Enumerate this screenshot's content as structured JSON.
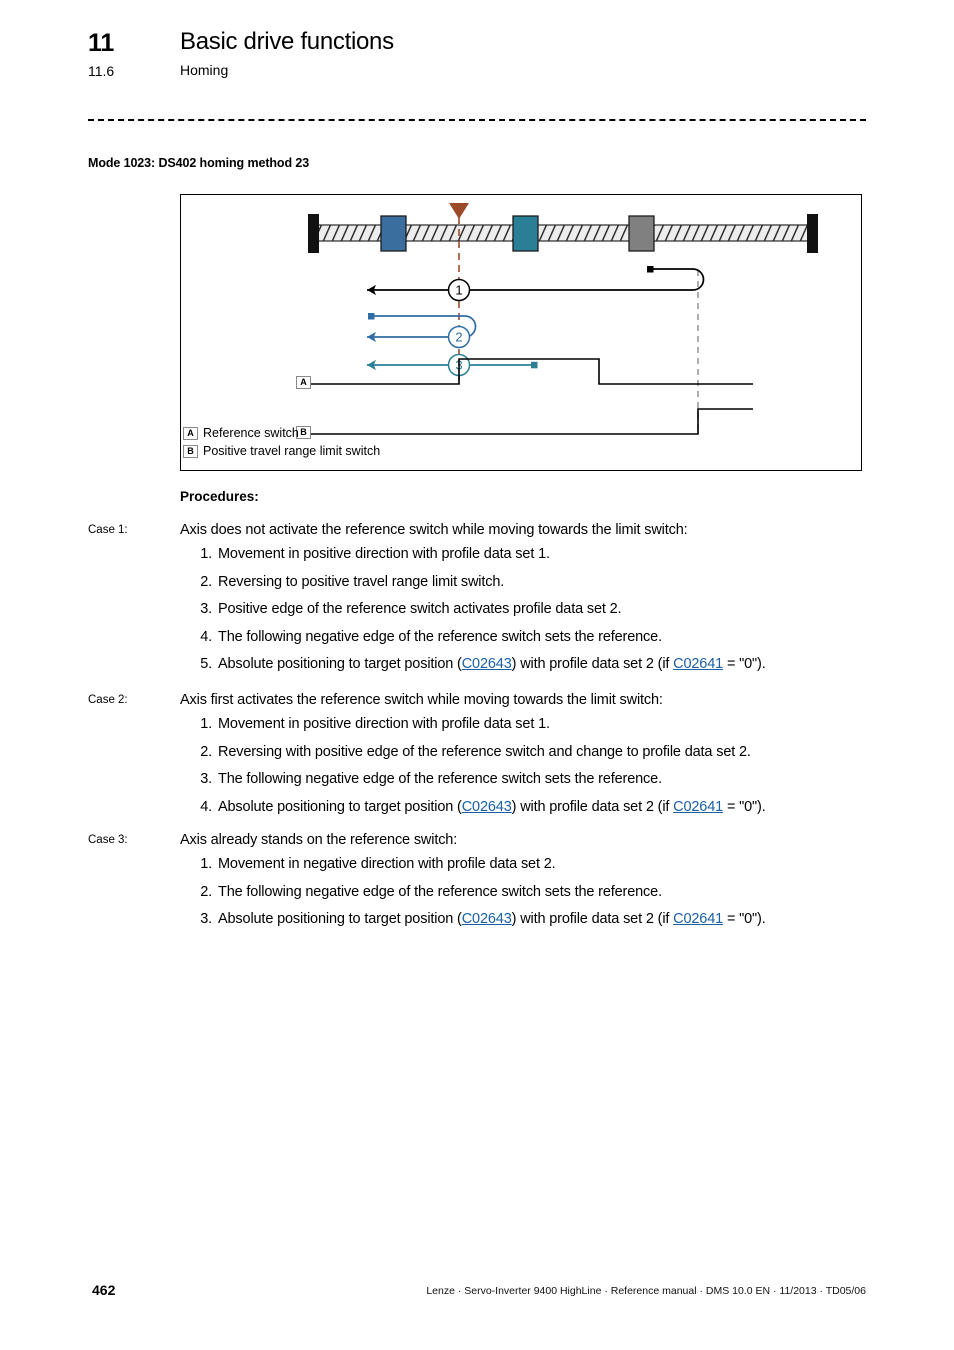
{
  "header": {
    "chapter_number": "11",
    "chapter_title": "Basic drive functions",
    "section_number": "11.6",
    "section_title": "Homing"
  },
  "mode_title": "Mode 1023: DS402 homing method 23",
  "figure": {
    "legend": [
      {
        "tag": "A",
        "text": "Reference switch"
      },
      {
        "tag": "B",
        "text": "Positive travel range limit switch"
      }
    ],
    "signal_labels": [
      "A",
      "B"
    ],
    "trajectory_markers": [
      "1",
      "2",
      "3"
    ],
    "colors": {
      "slider_blue": "#3a6e9e",
      "slider_teal": "#2a7f96",
      "slider_gray": "#808080",
      "endstop_black": "#111111",
      "rail_fill": "#e8e8e8",
      "reference_marker": "#9c4a2a",
      "trajectory_1": "#000000",
      "trajectory_2": "#2e6da4",
      "trajectory_3": "#2a7f96",
      "dashed_gray": "#999999"
    }
  },
  "procedures": {
    "heading": "Procedures:",
    "cases": [
      {
        "label": "Case 1:",
        "title": "Axis does not activate the reference switch while moving towards the limit switch:",
        "steps": [
          {
            "num": "1.",
            "pre": "Movement in positive direction with profile data set 1.",
            "link1": "",
            "mid": "",
            "link2": "",
            "post": ""
          },
          {
            "num": "2.",
            "pre": "Reversing to positive travel range limit switch.",
            "link1": "",
            "mid": "",
            "link2": "",
            "post": ""
          },
          {
            "num": "3.",
            "pre": "Positive edge of the reference switch activates profile data set 2.",
            "link1": "",
            "mid": "",
            "link2": "",
            "post": ""
          },
          {
            "num": "4.",
            "pre": "The following negative edge of the reference switch sets the reference.",
            "link1": "",
            "mid": "",
            "link2": "",
            "post": ""
          },
          {
            "num": "5.",
            "pre": "Absolute positioning to target position (",
            "link1": "C02643",
            "mid": ") with profile data set 2 (if ",
            "link2": "C02641",
            "post": " = \"0\")."
          }
        ]
      },
      {
        "label": "Case 2:",
        "title": "Axis first activates the reference switch while moving towards the limit switch:",
        "steps": [
          {
            "num": "1.",
            "pre": "Movement in positive direction with profile data set 1.",
            "link1": "",
            "mid": "",
            "link2": "",
            "post": ""
          },
          {
            "num": "2.",
            "pre": "Reversing with positive edge of the reference switch and change to profile data set 2.",
            "link1": "",
            "mid": "",
            "link2": "",
            "post": ""
          },
          {
            "num": "3.",
            "pre": "The following negative edge of the reference switch sets the reference.",
            "link1": "",
            "mid": "",
            "link2": "",
            "post": ""
          },
          {
            "num": "4.",
            "pre": "Absolute positioning to target position (",
            "link1": "C02643",
            "mid": ") with profile data set 2 (if ",
            "link2": "C02641",
            "post": " = \"0\")."
          }
        ]
      },
      {
        "label": "Case 3:",
        "title": "Axis already stands on the reference switch:",
        "steps": [
          {
            "num": "1.",
            "pre": "Movement in negative direction with profile data set 2.",
            "link1": "",
            "mid": "",
            "link2": "",
            "post": ""
          },
          {
            "num": "2.",
            "pre": "The following negative edge of the reference switch sets the reference.",
            "link1": "",
            "mid": "",
            "link2": "",
            "post": ""
          },
          {
            "num": "3.",
            "pre": "Absolute positioning to target position (",
            "link1": "C02643",
            "mid": ") with profile data set 2 (if ",
            "link2": "C02641",
            "post": " = \"0\")."
          }
        ]
      }
    ]
  },
  "footer": {
    "page_number": "462",
    "text": "Lenze · Servo-Inverter 9400 HighLine · Reference manual · DMS 10.0 EN · 11/2013 · TD05/06"
  }
}
